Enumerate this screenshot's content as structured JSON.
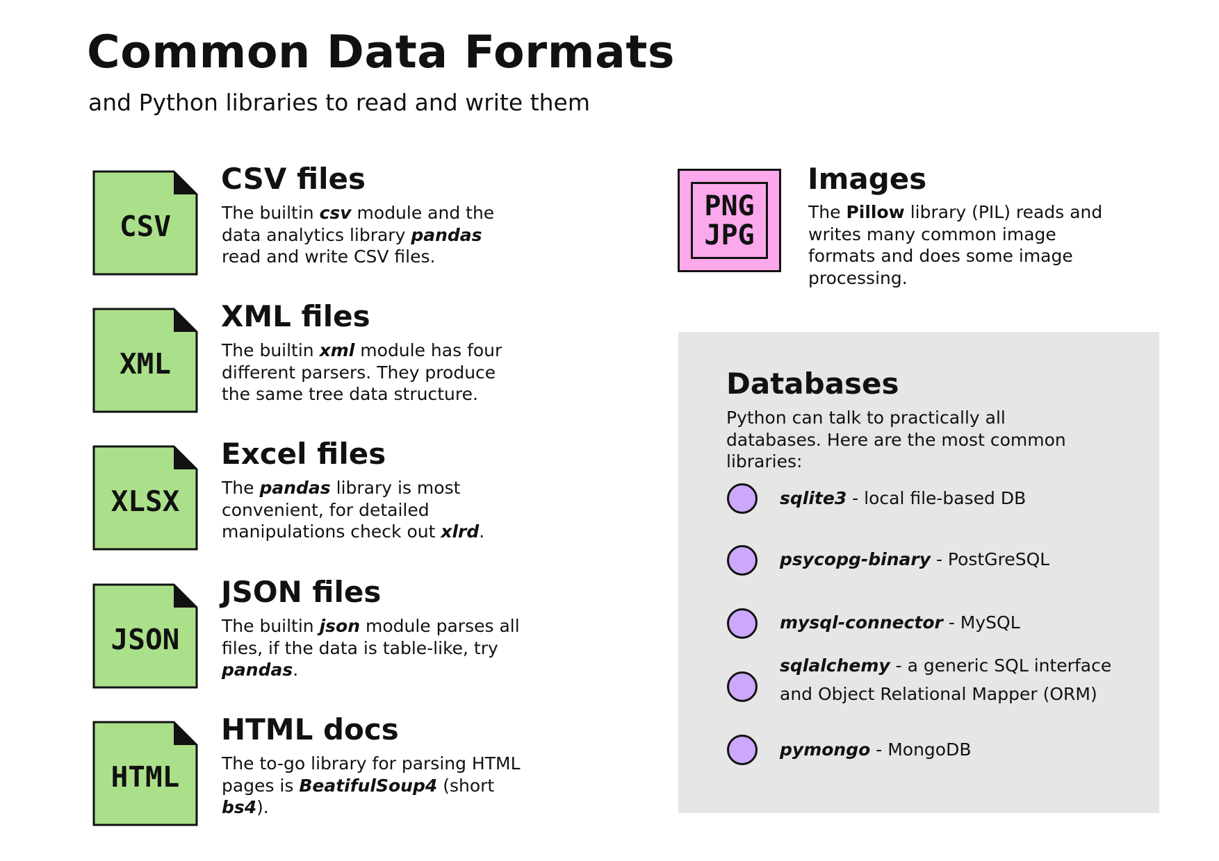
{
  "header": {
    "title": "Common Data Formats",
    "subtitle": "and Python libraries to read and write them"
  },
  "formats": [
    {
      "icon_label": "CSV",
      "title": "CSV files",
      "desc": [
        "The builtin ",
        "csv",
        " module and the data analytics library ",
        "pandas",
        " read and write CSV files."
      ]
    },
    {
      "icon_label": "XML",
      "title": "XML files",
      "desc": [
        "The builtin ",
        "xml",
        " module has four different parsers. They produce the same tree data structure."
      ]
    },
    {
      "icon_label": "XLSX",
      "title": "Excel files",
      "desc": [
        "The ",
        "pandas",
        " library is most convenient, for detailed manipulations check out ",
        "xlrd",
        "."
      ]
    },
    {
      "icon_label": "JSON",
      "title": "JSON files",
      "desc": [
        "The builtin ",
        "json",
        " module parses all files, if the data is table-like, try ",
        "pandas",
        "."
      ]
    },
    {
      "icon_label": "HTML",
      "title": "HTML docs",
      "desc": [
        "The to-go library for parsing HTML pages is ",
        "BeatifulSoup4",
        " (short ",
        "bs4",
        ")."
      ]
    }
  ],
  "images": {
    "icon_line1": "PNG",
    "icon_line2": "JPG",
    "title": "Images",
    "desc_pre": "The ",
    "desc_bold": "Pillow",
    "desc_post": " library (PIL) reads and writes many common image formats and does some image processing."
  },
  "databases": {
    "title": "Databases",
    "desc": "Python can talk to practically all databases. Here are the most common libraries:",
    "items": [
      {
        "name": "sqlite3",
        "text": " - local file-based DB"
      },
      {
        "name": "psycopg-binary",
        "text": " - PostGreSQL"
      },
      {
        "name": "mysql-connector",
        "text": " - MySQL"
      },
      {
        "name": "sqlalchemy",
        "text": " - a generic SQL interface and Object Relational Mapper (ORM)"
      },
      {
        "name": "pymongo",
        "text": " - MongoDB"
      }
    ]
  },
  "colors": {
    "file_icon_fill": "#abe08a",
    "image_icon_fill": "#fba8ec",
    "db_dot_fill": "#cba8f9",
    "db_panel_bg": "#e6e6e6"
  }
}
